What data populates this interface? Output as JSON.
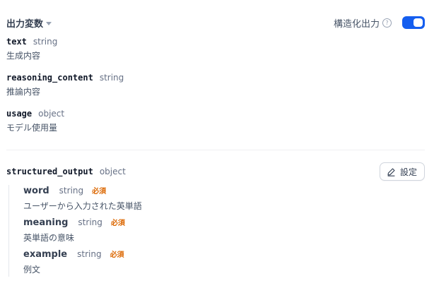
{
  "header": {
    "title": "出力変数",
    "structured_output_label": "構造化出力",
    "help_glyph": "?",
    "toggle_on": true,
    "accent_color": "#155eef"
  },
  "variables": [
    {
      "name": "text",
      "type": "string",
      "description": "生成内容"
    },
    {
      "name": "reasoning_content",
      "type": "string",
      "description": "推論内容"
    },
    {
      "name": "usage",
      "type": "object",
      "description": "モデル使用量"
    }
  ],
  "structured": {
    "name": "structured_output",
    "type": "object",
    "settings_label": "設定",
    "fields": [
      {
        "name": "word",
        "type": "string",
        "required_label": "必須",
        "description": "ユーザーから入力された英単語"
      },
      {
        "name": "meaning",
        "type": "string",
        "required_label": "必須",
        "description": "英単語の意味"
      },
      {
        "name": "example",
        "type": "string",
        "required_label": "必須",
        "description": "例文"
      }
    ]
  }
}
